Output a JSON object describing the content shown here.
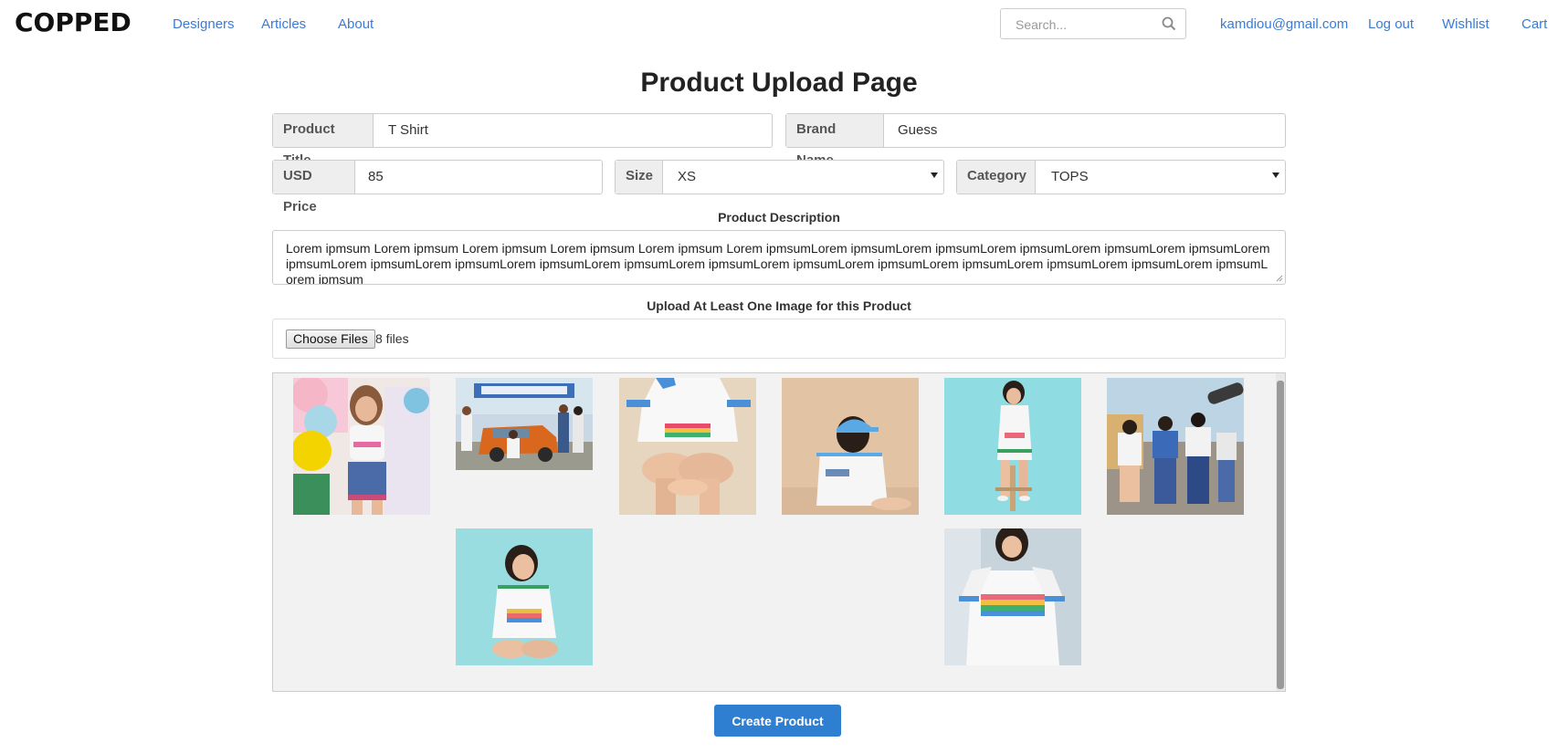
{
  "nav": {
    "logo": "COPPED",
    "links": [
      "Designers",
      "Articles",
      "About"
    ],
    "search_placeholder": "Search...",
    "user_email": "kamdiou@gmail.com",
    "logout": "Log out",
    "wishlist": "Wishlist",
    "cart": "Cart"
  },
  "page": {
    "title": "Product Upload Page"
  },
  "form": {
    "product_title": {
      "label": "Product Title",
      "value": "T Shirt"
    },
    "brand_name": {
      "label": "Brand Name",
      "value": "Guess"
    },
    "price": {
      "label": "USD Price",
      "value": "85"
    },
    "size": {
      "label": "Size",
      "value": "XS"
    },
    "category": {
      "label": "Category",
      "value": "TOPS"
    },
    "description": {
      "label": "Product Description",
      "value": "Lorem ipmsum Lorem ipmsum Lorem ipmsum Lorem ipmsum Lorem ipmsum Lorem ipmsumLorem ipmsumLorem ipmsumLorem ipmsumLorem ipmsumLorem ipmsumLorem ipmsumLorem ipmsumLorem ipmsumLorem ipmsumLorem ipmsumLorem ipmsumLorem ipmsumLorem ipmsumLorem ipmsumLorem ipmsumLorem ipmsumLorem ipmsumLorem ipmsum"
    },
    "upload": {
      "label": "Upload At Least One Image for this Product",
      "button": "Choose Files",
      "count": "8 files"
    },
    "submit": "Create Product"
  },
  "colors": {
    "link": "#3a7bd5",
    "button": "#2e7fd1",
    "addon_bg": "#eeeeee",
    "gallery_bg": "#f2f2f2"
  },
  "gallery": {
    "images": [
      "woman-with-balloons-photo",
      "group-with-orange-car-photo",
      "seated-tshirt-closeup-photo",
      "woman-in-cap-back-view-photo",
      "woman-on-stool-teal-photo",
      "group-skateboard-street-photo",
      "woman-sitting-teal-photo",
      "woman-tshirt-front-photo"
    ]
  }
}
